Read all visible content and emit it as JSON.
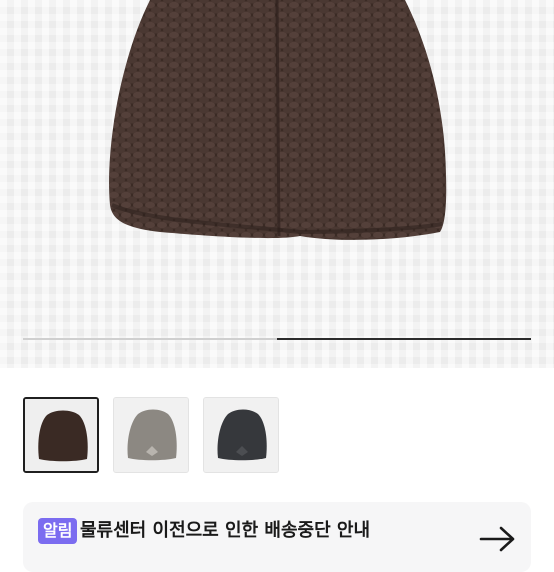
{
  "product": {
    "main_image_icon": "beanie-brown",
    "gallery_progress": 0.5
  },
  "thumbnails": [
    {
      "icon": "beanie-brown",
      "color": "#3a2a24",
      "selected": true
    },
    {
      "icon": "beanie-gray",
      "color": "#8c8882",
      "selected": false
    },
    {
      "icon": "beanie-charcoal",
      "color": "#36383c",
      "selected": false
    }
  ],
  "notice": {
    "badge": "알림",
    "title": "물류센터 이전으로 인한 배송중단 안내",
    "arrow_icon": "arrow-right-icon",
    "accent_color": "#7b6cf0"
  }
}
